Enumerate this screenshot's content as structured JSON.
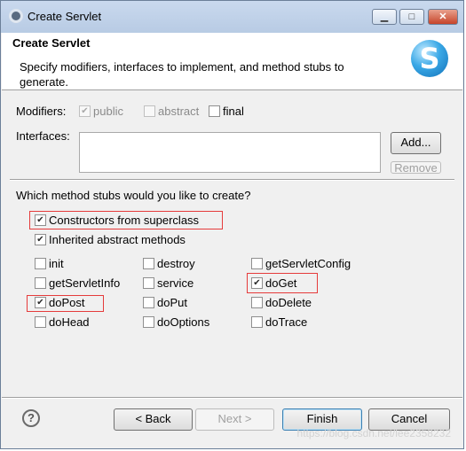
{
  "window": {
    "title": "Create Servlet",
    "title_icon": "eclipse-gear-icon",
    "min_glyph": "▁",
    "max_glyph": "□",
    "close_glyph": "✕"
  },
  "header": {
    "title": "Create Servlet",
    "description": "Specify modifiers, interfaces to implement, and method stubs to generate.",
    "logo_glyph": "S"
  },
  "modifiers": {
    "label": "Modifiers:",
    "options": [
      {
        "label": "public",
        "checked": true,
        "disabled": true
      },
      {
        "label": "abstract",
        "checked": false,
        "disabled": true
      },
      {
        "label": "final",
        "checked": false,
        "disabled": false
      }
    ]
  },
  "interfaces": {
    "label": "Interfaces:",
    "add_button": "Add...",
    "remove_button": "Remove"
  },
  "stubs": {
    "question": "Which method stubs would you like to create?",
    "constructors": {
      "label": "Constructors from superclass",
      "checked": true
    },
    "inherited": {
      "label": "Inherited abstract methods",
      "checked": true
    },
    "methods": [
      {
        "label": "init",
        "checked": false
      },
      {
        "label": "destroy",
        "checked": false
      },
      {
        "label": "getServletConfig",
        "checked": false
      },
      {
        "label": "getServletInfo",
        "checked": false
      },
      {
        "label": "service",
        "checked": false
      },
      {
        "label": "doGet",
        "checked": true
      },
      {
        "label": "doPost",
        "checked": true
      },
      {
        "label": "doPut",
        "checked": false
      },
      {
        "label": "doDelete",
        "checked": false
      },
      {
        "label": "doHead",
        "checked": false
      },
      {
        "label": "doOptions",
        "checked": false
      },
      {
        "label": "doTrace",
        "checked": false
      }
    ]
  },
  "footer": {
    "help_glyph": "?",
    "back": "< Back",
    "next": "Next >",
    "finish": "Finish",
    "cancel": "Cancel"
  },
  "watermark": "https://blog.csdn.net/lee2358232",
  "colors": {
    "highlight": "#e53b3b",
    "accent": "#3c7fb1"
  }
}
